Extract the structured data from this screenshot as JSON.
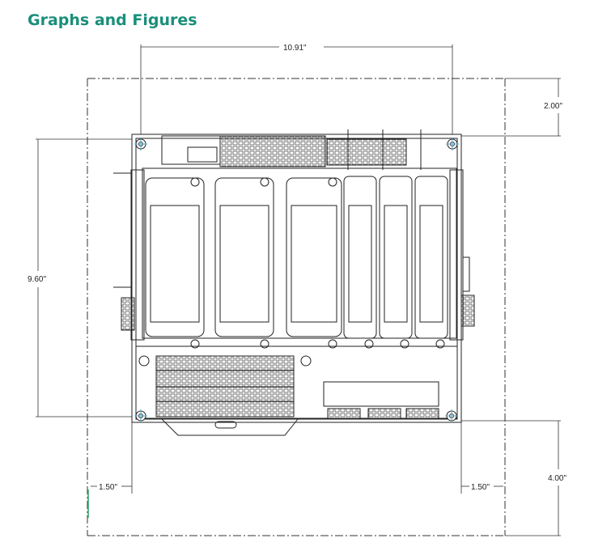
{
  "header": {
    "title": "Graphs and Figures"
  },
  "colors": {
    "title": "#1a8f7a",
    "line": "#222222",
    "marker": "#5aa9c9",
    "accent": "#2aa56a"
  },
  "dimensions": {
    "width_top": "10.91\"",
    "clearance_top": "2.00\"",
    "height_left": "9.60\"",
    "clearance_left": "1.50\"",
    "clearance_right": "1.50\"",
    "clearance_bottom": "4.00\""
  }
}
